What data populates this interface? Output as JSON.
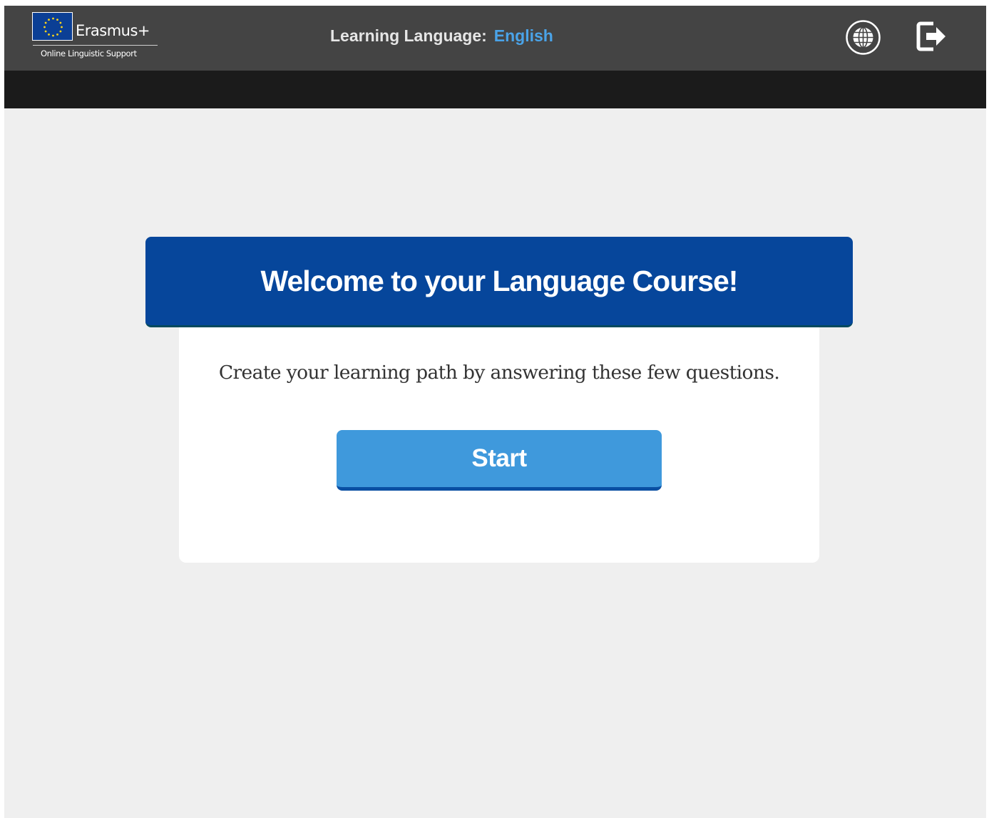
{
  "header": {
    "logo_word": "Erasmus+",
    "logo_subtitle": "Online Linguistic Support",
    "learning_language_label": "Learning Language:",
    "learning_language_value": "English",
    "icons": {
      "language": "globe-icon",
      "logout": "logout-icon"
    }
  },
  "main": {
    "welcome_title": "Welcome to your Language Course!",
    "intro_text": "Create your learning path by answering these few questions.",
    "start_label": "Start"
  },
  "colors": {
    "header_bg": "#444444",
    "subheader_bg": "#1b1b1b",
    "page_bg": "#efefef",
    "banner_bg": "#06469b",
    "button_bg": "#3f99dc",
    "accent_text": "#4aa3e8"
  }
}
